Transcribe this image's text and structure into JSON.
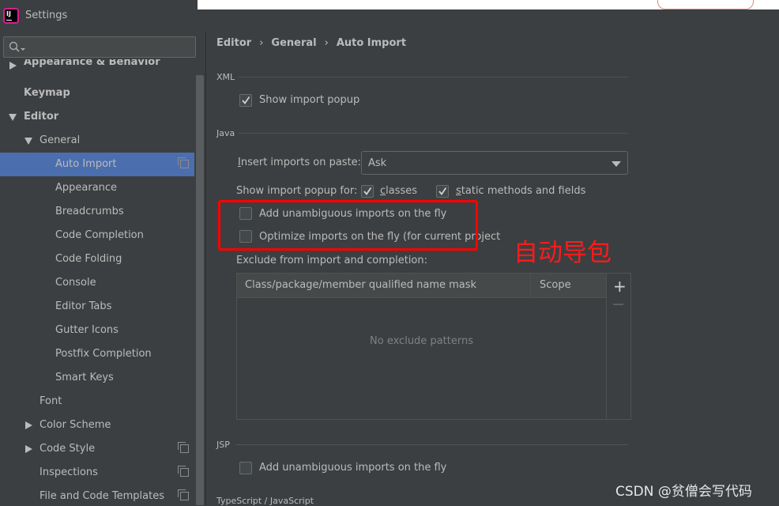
{
  "window": {
    "title": "Settings"
  },
  "sidebar": {
    "items": [
      {
        "label": "Appearance & Behavior"
      },
      {
        "label": "Keymap"
      },
      {
        "label": "Editor"
      },
      {
        "label": "General"
      },
      {
        "label": "Auto Import"
      },
      {
        "label": "Appearance"
      },
      {
        "label": "Breadcrumbs"
      },
      {
        "label": "Code Completion"
      },
      {
        "label": "Code Folding"
      },
      {
        "label": "Console"
      },
      {
        "label": "Editor Tabs"
      },
      {
        "label": "Gutter Icons"
      },
      {
        "label": "Postfix Completion"
      },
      {
        "label": "Smart Keys"
      },
      {
        "label": "Font"
      },
      {
        "label": "Color Scheme"
      },
      {
        "label": "Code Style"
      },
      {
        "label": "Inspections"
      },
      {
        "label": "File and Code Templates"
      }
    ]
  },
  "breadcrumb": [
    "Editor",
    "General",
    "Auto Import"
  ],
  "xml": {
    "section": "XML",
    "show_popup": {
      "label": "Show import popup",
      "checked": true
    }
  },
  "java": {
    "section": "Java",
    "insert_label_first": "I",
    "insert_label_rest": "nsert imports on paste:",
    "insert_value": "Ask",
    "popup_for_label": "Show import popup for:",
    "classes": {
      "label_first": "c",
      "label_rest": "lasses",
      "checked": true
    },
    "static": {
      "label_first": "s",
      "label_rest": "tatic methods and fields",
      "checked": true
    },
    "add_unambiguous": {
      "label": "Add unambiguous imports on the fly",
      "checked": false
    },
    "optimize": {
      "label": "Optimize imports on the fly (for current project",
      "checked": false
    },
    "exclude_label": "Exclude from import and completion:",
    "table": {
      "col1": "Class/package/member qualified name mask",
      "col2": "Scope",
      "empty": "No exclude patterns"
    }
  },
  "annotation": "自动导包",
  "jsp": {
    "section": "JSP",
    "add_unambiguous": {
      "label": "Add unambiguous imports on the fly",
      "checked": false
    }
  },
  "typescript": {
    "section": "TypeScript / JavaScript"
  },
  "watermark": "CSDN @贫僧会写代码"
}
